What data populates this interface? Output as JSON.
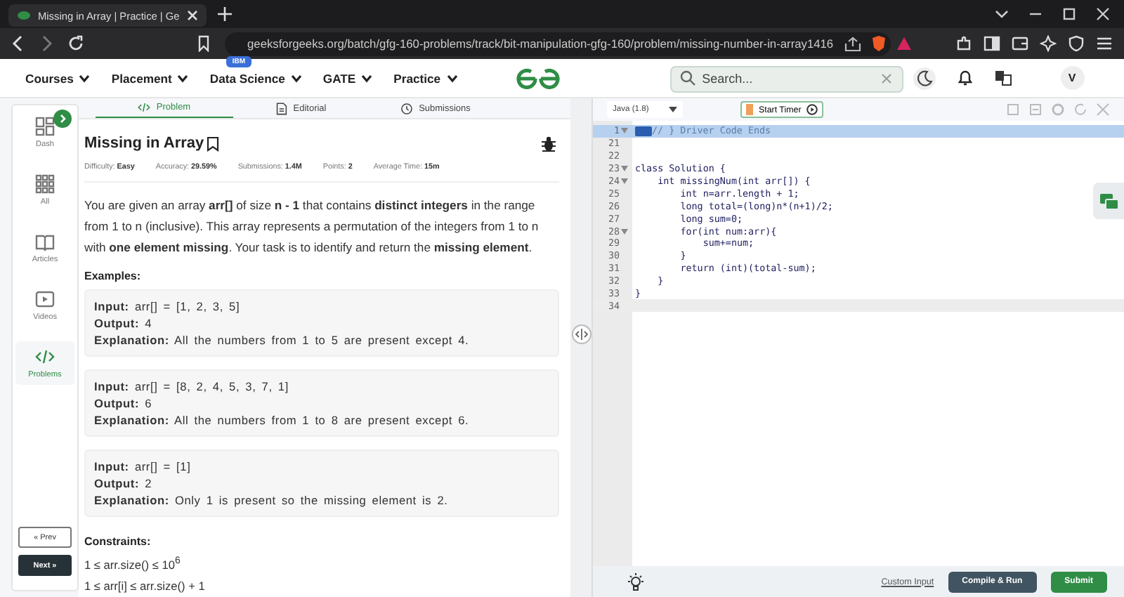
{
  "browser": {
    "tab": {
      "title": "Missing in Array | Practice | Ge"
    },
    "url": "geeksforgeeks.org/batch/gfg-160-problems/track/bit-manipulation-gfg-160/problem/missing-number-in-array1416"
  },
  "nav": {
    "items": [
      {
        "label": "Courses"
      },
      {
        "label": "Placement"
      },
      {
        "label": "Data Science",
        "badge": "IBM"
      },
      {
        "label": "GATE"
      },
      {
        "label": "Practice"
      }
    ],
    "search": {
      "placeholder": "Search..."
    },
    "avatar": "V"
  },
  "sidebar": {
    "items": [
      {
        "label": "Dash",
        "selected": false
      },
      {
        "label": "All",
        "selected": false
      },
      {
        "label": "Articles",
        "selected": false
      },
      {
        "label": "Videos",
        "selected": false
      },
      {
        "label": "Problems",
        "selected": true
      }
    ],
    "prev": "« Prev",
    "next": "Next »"
  },
  "problem": {
    "tabs": [
      {
        "label": "Problem",
        "selected": true
      },
      {
        "label": "Editorial",
        "selected": false
      },
      {
        "label": "Submissions",
        "selected": false
      }
    ],
    "title": "Missing in Array",
    "meta": [
      {
        "label": "Difficulty:",
        "value": "Easy"
      },
      {
        "label": "Accuracy:",
        "value": "29.59%"
      },
      {
        "label": "Submissions:",
        "value": "1.4M"
      },
      {
        "label": "Points:",
        "value": "2"
      },
      {
        "label": "Average Time:",
        "value": "15m"
      }
    ],
    "description": "You are given an array **arr[]** of size **n - 1** that contains **distinct integers** in the range from 1 to n (inclusive). This array represents a permutation of the integers from 1 to n with **one element missing**. Your task is to identify and return the **missing element**.",
    "examples_heading": "Examples:",
    "examples": [
      {
        "lines": [
          "**Input:** arr[] = [1, 2, 3, 5]",
          "**Output:** 4",
          "**Explanation:** All the numbers from 1 to 5 are present except 4."
        ]
      },
      {
        "lines": [
          "**Input:** arr[] = [8, 2, 4, 5, 3, 7, 1]",
          "**Output:** 6",
          "**Explanation:** All the numbers from 1 to 8 are present except 6."
        ]
      },
      {
        "lines": [
          "**Input:** arr[] = [1]",
          "**Output:** 2",
          "**Explanation:** Only 1 is present so the missing element is 2."
        ]
      }
    ],
    "constraints_heading": "Constraints:",
    "constraints": [
      "1 ≤ arr.size() ≤ 10$^{6}$",
      "1 ≤ arr[i] ≤ arr.size() + 1"
    ]
  },
  "editor": {
    "language": "Java (1.8)",
    "timer": "Start Timer",
    "lines": [
      {
        "number": "1",
        "text": "// } Driver Code Ends",
        "foldable": true,
        "folded": true,
        "highlighted": true,
        "current": false
      },
      {
        "number": "21",
        "foldable": false,
        "folded": false,
        "highlighted": false,
        "current": false
      },
      {
        "number": "22",
        "foldable": false,
        "folded": false,
        "highlighted": false,
        "current": false
      },
      {
        "number": "23",
        "text": "class Solution {",
        "foldable": true,
        "folded": false,
        "highlighted": false,
        "current": false
      },
      {
        "number": "24",
        "text": "    int missingNum(int arr[]) {",
        "foldable": true,
        "folded": false,
        "highlighted": false,
        "current": false
      },
      {
        "number": "25",
        "text": "        int n=arr.length + 1;",
        "foldable": false,
        "folded": false,
        "highlighted": false,
        "current": false
      },
      {
        "number": "26",
        "text": "        long total=(long)n*(n+1)/2;",
        "foldable": false,
        "folded": false,
        "highlighted": false,
        "current": false
      },
      {
        "number": "27",
        "text": "        long sum=0;",
        "foldable": false,
        "folded": false,
        "highlighted": false,
        "current": false
      },
      {
        "number": "28",
        "text": "        for(int num:arr){",
        "foldable": true,
        "folded": false,
        "highlighted": false,
        "current": false
      },
      {
        "number": "29",
        "text": "            sum+=num;",
        "foldable": false,
        "folded": false,
        "highlighted": false,
        "current": false
      },
      {
        "number": "30",
        "text": "        }",
        "foldable": false,
        "folded": false,
        "highlighted": false,
        "current": false
      },
      {
        "number": "31",
        "text": "        return (int)(total-sum);",
        "foldable": false,
        "folded": false,
        "highlighted": false,
        "current": false
      },
      {
        "number": "32",
        "text": "    }",
        "foldable": false,
        "folded": false,
        "highlighted": false,
        "current": false
      },
      {
        "number": "33",
        "text": "}",
        "foldable": false,
        "folded": false,
        "highlighted": false,
        "current": false
      },
      {
        "number": "34",
        "foldable": false,
        "folded": false,
        "highlighted": false,
        "current": true
      }
    ],
    "custom_input": "Custom Input",
    "compile": "Compile & Run",
    "submit": "Submit"
  }
}
